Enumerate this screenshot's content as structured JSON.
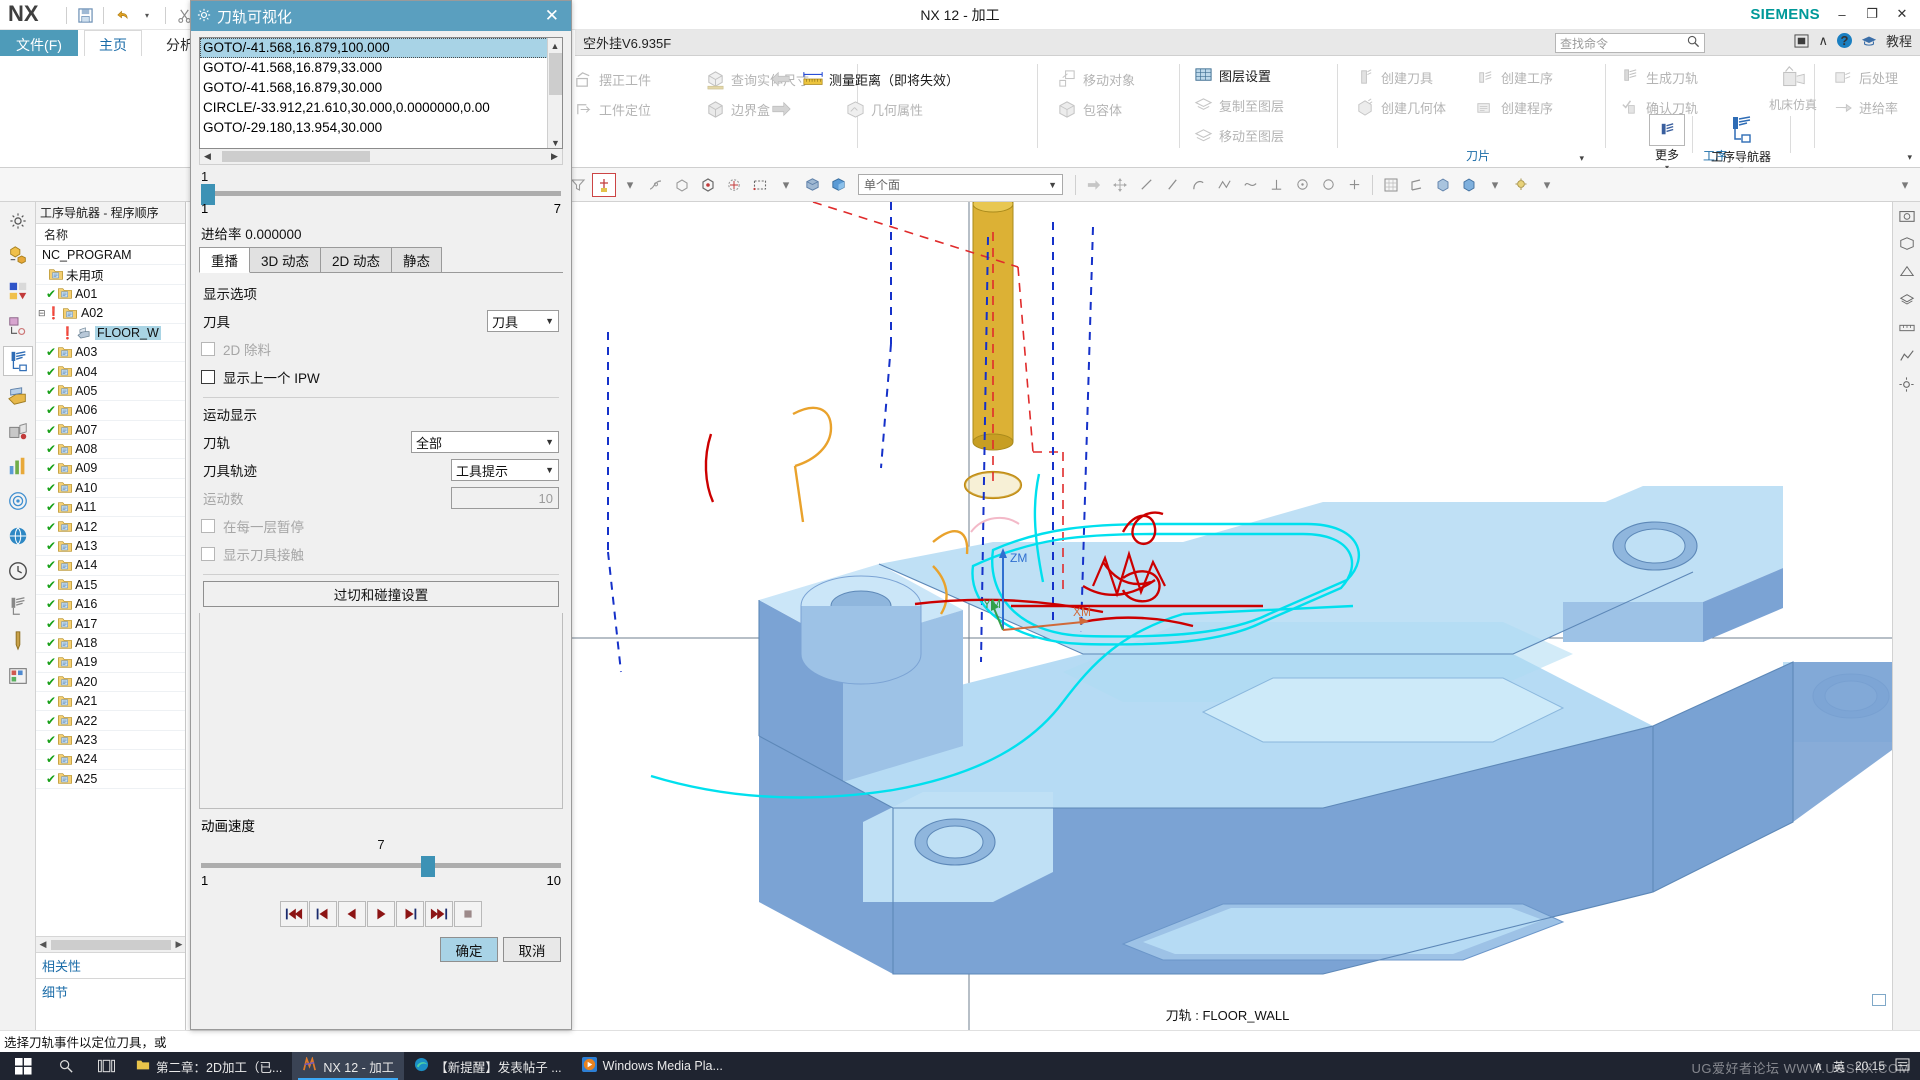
{
  "window": {
    "app_name": "NX",
    "title": "NX 12 - 加工",
    "brand": "SIEMENS",
    "document_title": "空外挂V6.935F",
    "minimize": "–",
    "maximize": "❐",
    "close": "✕"
  },
  "ribbon": {
    "tabs": [
      {
        "label": "文件(F)",
        "active": false,
        "is_file": true
      },
      {
        "label": "主页",
        "active": true
      },
      {
        "label": "分析",
        "active": false
      }
    ],
    "search": {
      "placeholder": "查找命令",
      "icon": "search-icon"
    },
    "help": {
      "restore": "窗口",
      "collapse": "折叠功能区",
      "question": "?",
      "tutorial": "教程"
    },
    "groups": [
      {
        "label": "",
        "items": [
          {
            "label": "摆正工件",
            "enabled": false
          },
          {
            "label": "工件定位",
            "enabled": false
          }
        ]
      },
      {
        "label": "",
        "items": [
          {
            "label": "查询实体尺寸",
            "enabled": false
          },
          {
            "label": "边界盒",
            "enabled": false
          }
        ]
      },
      {
        "label": "",
        "items": [
          {
            "label": "测量距离（即将失效）",
            "enabled": true
          },
          {
            "label": "几何属性",
            "enabled": false
          }
        ]
      },
      {
        "label": "",
        "items": [
          {
            "label": "移动对象",
            "enabled": false
          },
          {
            "label": "包容体",
            "enabled": false
          }
        ]
      },
      {
        "label": "",
        "items": [
          {
            "label": "图层设置",
            "enabled": true
          },
          {
            "label": "复制至图层",
            "enabled": false
          },
          {
            "label": "移动至图层",
            "enabled": false
          }
        ]
      },
      {
        "label": "刀片",
        "items": [
          {
            "label": "创建刀具",
            "enabled": false
          },
          {
            "label": "创建几何体",
            "enabled": false
          },
          {
            "label": "创建工序",
            "enabled": false
          },
          {
            "label": "创建程序",
            "enabled": false
          }
        ]
      },
      {
        "label": "工序",
        "items": [
          {
            "label": "生成刀轨",
            "enabled": false
          },
          {
            "label": "确认刀轨",
            "enabled": false
          },
          {
            "label": "机床仿真",
            "enabled": false
          },
          {
            "label": "后处理",
            "enabled": false
          },
          {
            "label": "进给率",
            "enabled": false
          }
        ]
      }
    ],
    "big_buttons": [
      {
        "label": "更多",
        "enabled": true
      },
      {
        "label": "工序导航器",
        "enabled": true
      }
    ]
  },
  "view_toolbar": {
    "filter_value": "单个面",
    "icons": [
      "filter-icon",
      "snap-point-icon",
      "chevron-down-icon",
      "point-on-curve-icon",
      "face-select-icon",
      "circle-center-icon",
      "quadrant-icon",
      "rectangle-select-icon",
      "chevron-down-icon",
      "shade-icon",
      "render-style-icon"
    ],
    "right_icons": [
      "arrow-right-icon",
      "move-icon",
      "line-icon",
      "line2-icon",
      "arc-icon",
      "spline-icon",
      "wave-icon",
      "perpendicular-icon",
      "circle-dot-icon",
      "circle-icon",
      "plus-icon",
      "grid-icon",
      "datum-icon",
      "cube-icon",
      "cube2-icon",
      "layer-icon",
      "chevron-down-icon",
      "light-icon",
      "chevron-down-icon"
    ]
  },
  "left_rail": {
    "icons": [
      "gear-icon",
      "assembly-navigator-icon",
      "part-navigator-icon",
      "reuse-library-icon",
      "operation-navigator-icon",
      "machine-tool-icon",
      "manufacturing-wizard-icon",
      "history-icon",
      "roughing-icon",
      "web-browser-icon",
      "recent-icon",
      "rail-icon-11",
      "rail-icon-12",
      "rail-icon-13"
    ],
    "selected_index": 4
  },
  "navigator": {
    "header": "工序导航器 - 程序顺序",
    "column_header": "名称",
    "root": "NC_PROGRAM",
    "rows": [
      {
        "label": "未用项",
        "status": "none",
        "depth": 1,
        "type": "folder"
      },
      {
        "label": "A01",
        "status": "ok",
        "depth": 1,
        "type": "folder"
      },
      {
        "label": "A02",
        "status": "warn",
        "depth": 1,
        "type": "folder",
        "expanded": true
      },
      {
        "label": "FLOOR_W",
        "status": "warn",
        "depth": 2,
        "type": "operation",
        "selected": true
      },
      {
        "label": "A03",
        "status": "ok",
        "depth": 1,
        "type": "folder"
      },
      {
        "label": "A04",
        "status": "ok",
        "depth": 1,
        "type": "folder"
      },
      {
        "label": "A05",
        "status": "ok",
        "depth": 1,
        "type": "folder"
      },
      {
        "label": "A06",
        "status": "ok",
        "depth": 1,
        "type": "folder"
      },
      {
        "label": "A07",
        "status": "ok",
        "depth": 1,
        "type": "folder"
      },
      {
        "label": "A08",
        "status": "ok",
        "depth": 1,
        "type": "folder"
      },
      {
        "label": "A09",
        "status": "ok",
        "depth": 1,
        "type": "folder"
      },
      {
        "label": "A10",
        "status": "ok",
        "depth": 1,
        "type": "folder"
      },
      {
        "label": "A11",
        "status": "ok",
        "depth": 1,
        "type": "folder"
      },
      {
        "label": "A12",
        "status": "ok",
        "depth": 1,
        "type": "folder"
      },
      {
        "label": "A13",
        "status": "ok",
        "depth": 1,
        "type": "folder"
      },
      {
        "label": "A14",
        "status": "ok",
        "depth": 1,
        "type": "folder"
      },
      {
        "label": "A15",
        "status": "ok",
        "depth": 1,
        "type": "folder"
      },
      {
        "label": "A16",
        "status": "ok",
        "depth": 1,
        "type": "folder"
      },
      {
        "label": "A17",
        "status": "ok",
        "depth": 1,
        "type": "folder"
      },
      {
        "label": "A18",
        "status": "ok",
        "depth": 1,
        "type": "folder"
      },
      {
        "label": "A19",
        "status": "ok",
        "depth": 1,
        "type": "folder"
      },
      {
        "label": "A20",
        "status": "ok",
        "depth": 1,
        "type": "folder"
      },
      {
        "label": "A21",
        "status": "ok",
        "depth": 1,
        "type": "folder"
      },
      {
        "label": "A22",
        "status": "ok",
        "depth": 1,
        "type": "folder"
      },
      {
        "label": "A23",
        "status": "ok",
        "depth": 1,
        "type": "folder"
      },
      {
        "label": "A24",
        "status": "ok",
        "depth": 1,
        "type": "folder"
      },
      {
        "label": "A25",
        "status": "ok",
        "depth": 1,
        "type": "folder"
      }
    ],
    "sections": [
      {
        "label": "相关性"
      },
      {
        "label": "细节"
      }
    ]
  },
  "dialog": {
    "title": "刀轨可视化",
    "close": "✕",
    "gcode_lines": [
      {
        "text": "GOTO/-41.568,16.879,100.000",
        "selected": true
      },
      {
        "text": "GOTO/-41.568,16.879,33.000",
        "selected": false
      },
      {
        "text": "GOTO/-41.568,16.879,30.000",
        "selected": false
      },
      {
        "text": "CIRCLE/-33.912,21.610,30.000,0.0000000,0.00",
        "selected": false
      },
      {
        "text": "GOTO/-29.180,13.954,30.000",
        "selected": false
      }
    ],
    "progress_slider": {
      "top_value": "1",
      "min": "1",
      "max": "7"
    },
    "feed_rate_label": "进给率 0.000000",
    "tabs": [
      {
        "label": "重播",
        "active": true
      },
      {
        "label": "3D 动态",
        "active": false
      },
      {
        "label": "2D 动态",
        "active": false
      },
      {
        "label": "静态",
        "active": false
      }
    ],
    "display_options": {
      "header": "显示选项",
      "tool_label": "刀具",
      "tool_value": "刀具",
      "check_2d_removal": {
        "label": "2D 除料",
        "checked": false,
        "enabled": false
      },
      "check_show_ipw": {
        "label": "显示上一个 IPW",
        "checked": false,
        "enabled": true
      }
    },
    "motion_display": {
      "header": "运动显示",
      "toolpath_label": "刀轨",
      "toolpath_value": "全部",
      "trace_label": "刀具轨迹",
      "trace_value": "工具提示",
      "motion_count_label": "运动数",
      "motion_count_value": "10",
      "check_pause_each_layer": {
        "label": "在每一层暂停",
        "checked": false,
        "enabled": false
      },
      "check_show_contact": {
        "label": "显示刀具接触",
        "checked": false,
        "enabled": false
      },
      "gouge_button": "过切和碰撞设置"
    },
    "animation": {
      "label": "动画速度",
      "value": "7",
      "min": "1",
      "max": "10",
      "transport": [
        {
          "name": "rewind-all-button",
          "glyph": "first"
        },
        {
          "name": "step-back-all-button",
          "glyph": "prev"
        },
        {
          "name": "play-back-button",
          "glyph": "back"
        },
        {
          "name": "play-button",
          "glyph": "play"
        },
        {
          "name": "step-forward-button",
          "glyph": "next"
        },
        {
          "name": "forward-all-button",
          "glyph": "last"
        },
        {
          "name": "stop-button",
          "glyph": "stop"
        }
      ]
    },
    "ok_label": "确定",
    "cancel_label": "取消"
  },
  "viewport": {
    "caption": "刀轨 : FLOOR_WALL",
    "triad": {
      "zm": "ZM",
      "ym": "YM",
      "xm": "XM"
    },
    "colors": {
      "part_top": "#bfe0f5",
      "part_side": "#7fa9d8",
      "part_dark": "#6b96c9",
      "tool": "#d6a419",
      "rapid": "#dd2c2c",
      "cut": "#00e5ee",
      "engage": "#e8a93a",
      "feed": "#cc0000",
      "non_cut": "#1030c0"
    }
  },
  "statusbar": {
    "message": "选择刀轨事件以定位刀具，或"
  },
  "taskbar": {
    "start": "start-icon",
    "search": "search-icon",
    "taskview": "taskview-icon",
    "items": [
      {
        "label": "第二章：2D加工（已...",
        "icon": "folder-icon",
        "active": false
      },
      {
        "label": "NX 12 - 加工",
        "icon": "nx-icon",
        "active": true
      },
      {
        "label": "【新提醒】发表帖子 ...",
        "icon": "edge-icon",
        "active": false
      },
      {
        "label": "Windows Media Pla...",
        "icon": "wmp-icon",
        "active": false
      }
    ],
    "tray": {
      "chevron": "∧",
      "ime": "英",
      "time": "20:15"
    },
    "watermark": "UG爱好者论坛  WWW.UGSNX.COM"
  }
}
